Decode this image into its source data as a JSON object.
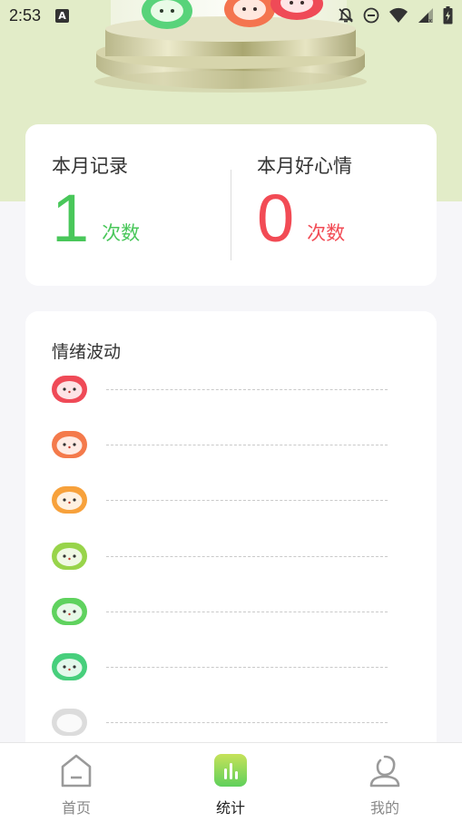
{
  "status_bar": {
    "time": "2:53",
    "indicator_letter": "A",
    "icons": [
      "notifications-off-icon",
      "do-not-disturb-icon",
      "wifi-icon",
      "cell-signal-icon",
      "battery-charging-icon"
    ]
  },
  "hero": {
    "illustration": "mood-jar-illustration",
    "background_color": "#e2ecc8"
  },
  "summary": {
    "monthly_records": {
      "label": "本月记录",
      "value": "1",
      "unit": "次数",
      "color": "#49c75a"
    },
    "monthly_good_mood": {
      "label": "本月好心情",
      "value": "0",
      "unit": "次数",
      "color": "#f24b55"
    }
  },
  "mood_chart": {
    "title": "情绪波动",
    "levels": [
      {
        "face": "red-mood-face-icon",
        "color": "#ef4a57"
      },
      {
        "face": "orange-red-mood-face-icon",
        "color": "#f47a4b"
      },
      {
        "face": "orange-mood-face-icon",
        "color": "#f7a13b"
      },
      {
        "face": "yellow-green-mood-face-icon",
        "color": "#98d44a"
      },
      {
        "face": "green-mood-face-icon",
        "color": "#5fd25e"
      },
      {
        "face": "teal-green-mood-face-icon",
        "color": "#47cf7c"
      },
      {
        "face": "gray-mood-face-icon",
        "color": "#dcdcdc"
      }
    ]
  },
  "tab_bar": {
    "tabs": [
      {
        "label": "首页",
        "icon": "home-icon",
        "active": false
      },
      {
        "label": "统计",
        "icon": "statistics-icon",
        "active": true
      },
      {
        "label": "我的",
        "icon": "profile-icon",
        "active": false
      }
    ],
    "active_color": "#6fd357"
  }
}
